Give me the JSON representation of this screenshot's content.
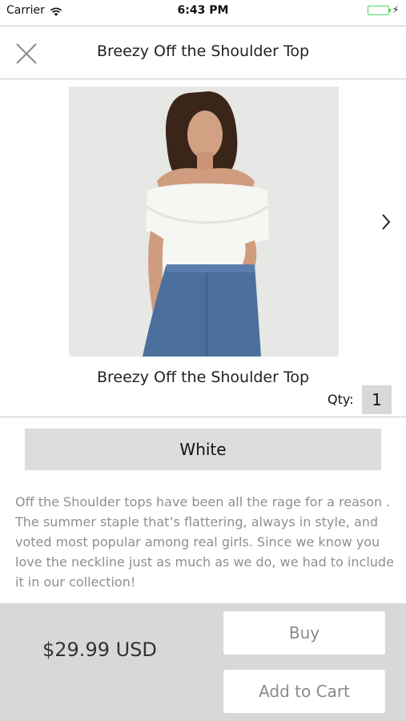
{
  "status_bar": {
    "carrier": "Carrier",
    "time": "6:43 PM"
  },
  "header": {
    "title": "Breezy Off the Shoulder Top"
  },
  "product": {
    "name": "Breezy Off the Shoulder Top",
    "qty_label": "Qty:",
    "qty_value": "1",
    "color": "White",
    "description": "Off the Shoulder tops have been all the rage for a reason . The summer staple that’s flattering, always in style, and voted most popular among real girls. Since we know you love the neckline just as much as we do, we had to include it in our collection!"
  },
  "footer": {
    "price": "$29.99 USD",
    "buy_label": "Buy",
    "add_to_cart_label": "Add to Cart"
  },
  "colors": {
    "accent_battery": "#4cd964",
    "footer_bg": "#d8d8d8",
    "select_bg": "#dcdcdc"
  }
}
